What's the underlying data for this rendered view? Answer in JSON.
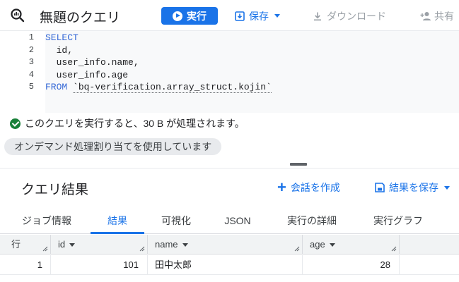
{
  "toolbar": {
    "title": "無題のクエリ",
    "run_label": "実行",
    "save_label": "保存",
    "download_label": "ダウンロード",
    "share_label": "共有"
  },
  "editor": {
    "lines": [
      {
        "num": "1",
        "kw": "SELECT",
        "text": ""
      },
      {
        "num": "2",
        "kw": "",
        "text": "  id,"
      },
      {
        "num": "3",
        "kw": "",
        "text": "  user_info.name,"
      },
      {
        "num": "4",
        "kw": "",
        "text": "  user_info.age"
      },
      {
        "num": "5",
        "kw": "FROM",
        "text": " ",
        "table": "`bq-verification.array_struct.kojin`"
      }
    ]
  },
  "status": {
    "message": "このクエリを実行すると、30 B が処理されます。",
    "chip": "オンデマンド処理割り当てを使用しています"
  },
  "results": {
    "title": "クエリ結果",
    "create_conversation": "会話を作成",
    "save_results": "結果を保存",
    "tabs": [
      "ジョブ情報",
      "結果",
      "可視化",
      "JSON",
      "実行の詳細",
      "実行グラフ"
    ],
    "active_tab": "結果",
    "columns": [
      "行",
      "id",
      "name",
      "age"
    ],
    "rows": [
      {
        "row": "1",
        "id": "101",
        "name": "田中太郎",
        "age": "28"
      }
    ]
  },
  "colors": {
    "accent": "#1a73e8",
    "success": "#188038"
  }
}
